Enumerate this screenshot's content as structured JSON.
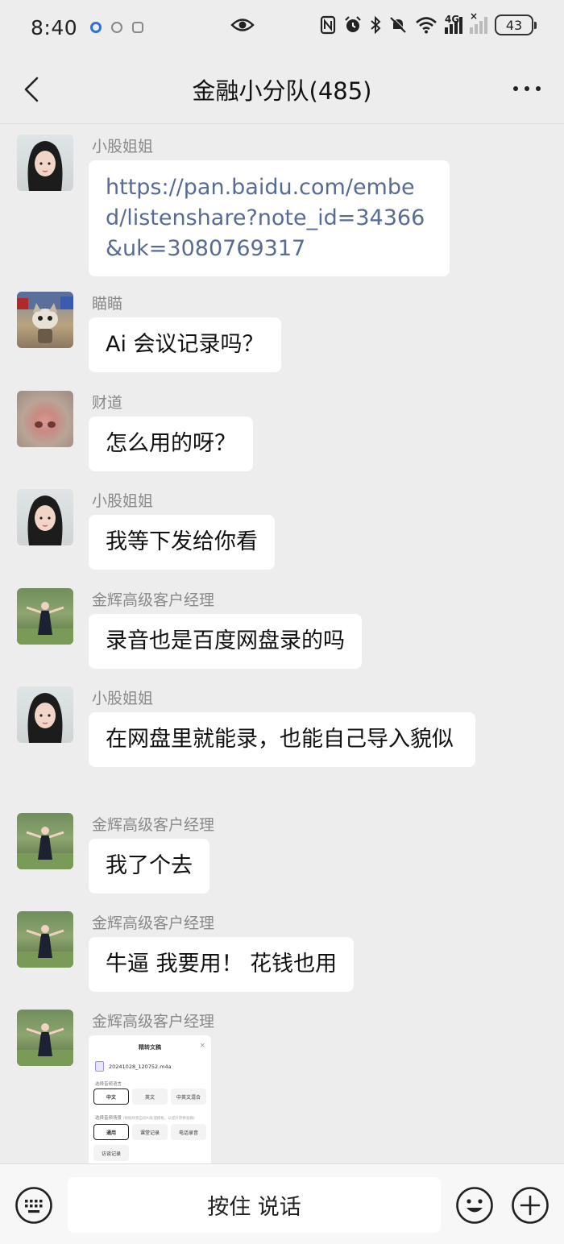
{
  "status_bar": {
    "time": "8:40",
    "network": "4G",
    "battery": "43",
    "icons": [
      "nfc-icon",
      "alarm-icon",
      "bluetooth-icon",
      "mute-icon",
      "wifi-icon",
      "signal-icon",
      "signal-off-icon",
      "eye-icon"
    ]
  },
  "header": {
    "title": "金融小分队(485)",
    "back_icon": "chevron-left-icon",
    "more_icon": "more-dots-icon"
  },
  "messages": [
    {
      "sender": "小股姐姐",
      "text": "https://pan.baidu.com/embed/listenshare?note_id=34366&uk=3080769317",
      "type": "link"
    },
    {
      "sender": "瞄瞄",
      "text": "Ai 会议记录吗？",
      "type": "text"
    },
    {
      "sender": "财道",
      "text": "怎么用的呀？",
      "type": "text"
    },
    {
      "sender": "小股姐姐",
      "text": "我等下发给你看",
      "type": "text"
    },
    {
      "sender": "金辉高级客户经理",
      "text": "录音也是百度网盘录的吗",
      "type": "text"
    },
    {
      "sender": "小股姐姐",
      "text": "在网盘里就能录，也能自己导入貌似",
      "type": "text"
    },
    {
      "sender": "金辉高级客户经理",
      "text": "我了个去",
      "type": "text"
    },
    {
      "sender": "金辉高级客户经理",
      "text": "牛逼 我要用！ 花钱也用",
      "type": "text"
    },
    {
      "sender": "金辉高级客户经理",
      "type": "image",
      "image": {
        "title": "精转文稿",
        "close": "×",
        "file": "20241028_120752.m4a",
        "lang_label": "选择音频语言",
        "lang_options": [
          "中文",
          "英文",
          "中英文混合"
        ],
        "scene_label": "选择音频场景",
        "scene_hint": "(根据场景自动AI处理模板，以提升转换准确)",
        "scene_options": [
          "通用",
          "课堂记录",
          "电话录音",
          "访谈记录"
        ]
      }
    }
  ],
  "input_bar": {
    "voice_label": "按住 说话",
    "keyboard_icon": "keyboard-icon",
    "emoji_icon": "emoji-icon",
    "plus_icon": "plus-icon"
  },
  "colors": {
    "background": "#ededed",
    "bubble": "#ffffff",
    "link": "#576b95",
    "sender": "#8a8a8a"
  }
}
